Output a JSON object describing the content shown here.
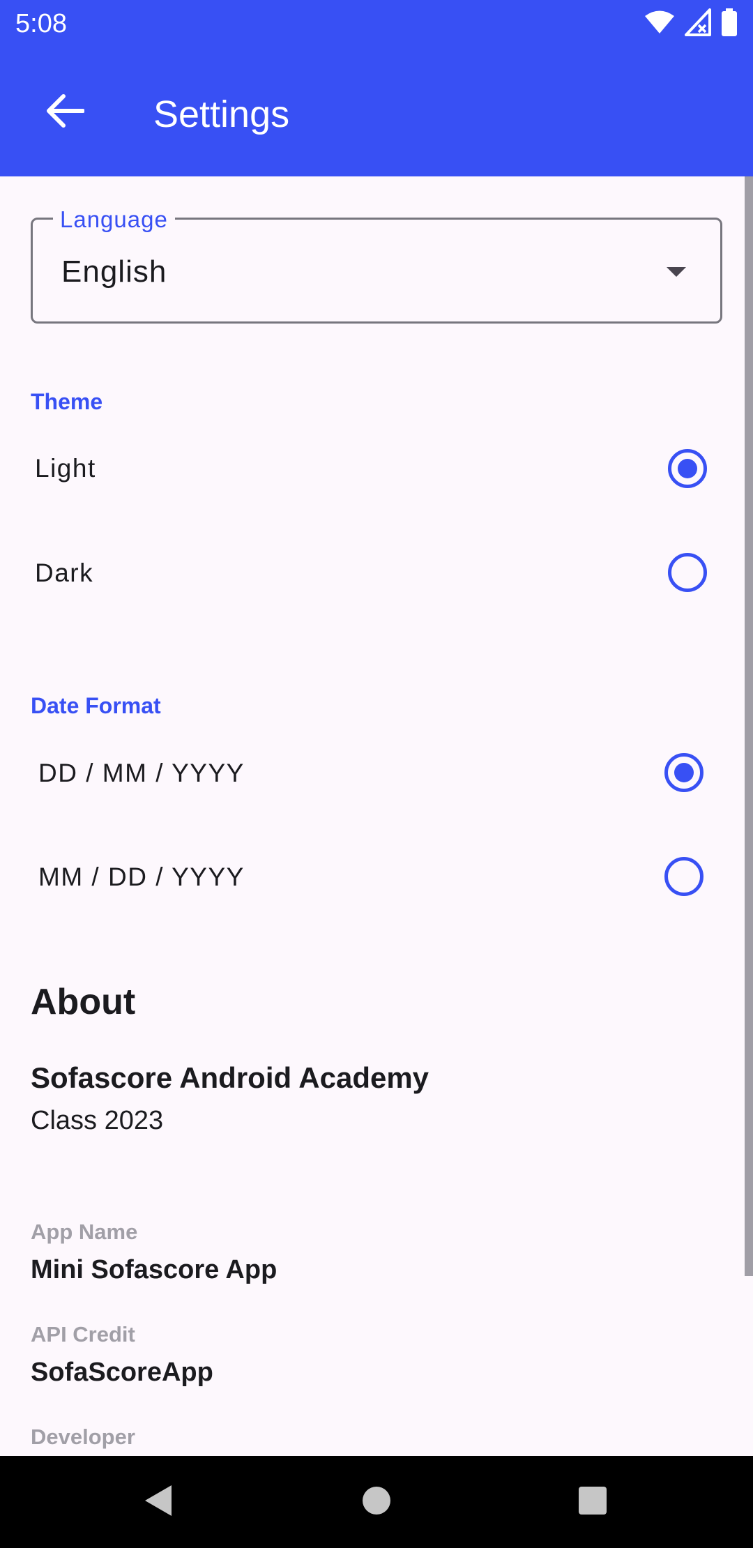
{
  "status_bar": {
    "time": "5:08",
    "icons": [
      "wifi-icon",
      "signal-off-icon",
      "battery-icon"
    ]
  },
  "app_bar": {
    "back_icon": "arrow-back-icon",
    "title": "Settings"
  },
  "language": {
    "label": "Language",
    "value": "English",
    "icon": "dropdown-arrow-icon"
  },
  "theme": {
    "title": "Theme",
    "options": [
      {
        "label": "Light",
        "selected": true
      },
      {
        "label": "Dark",
        "selected": false
      }
    ]
  },
  "date_format": {
    "title": "Date Format",
    "options": [
      {
        "label": "DD / MM / YYYY",
        "selected": true
      },
      {
        "label": "MM / DD / YYYY",
        "selected": false
      }
    ]
  },
  "about": {
    "title": "About",
    "org": "Sofascore Android Academy",
    "class": "Class 2023",
    "items": [
      {
        "label": "App Name",
        "value": "Mini Sofascore App"
      },
      {
        "label": "API Credit",
        "value": "SofaScoreApp"
      },
      {
        "label": "Developer",
        "value": ""
      }
    ]
  },
  "nav_bar": {
    "icons": [
      "nav-back-icon",
      "nav-home-icon",
      "nav-recents-icon"
    ]
  },
  "colors": {
    "primary": "#3850f4",
    "background": "#fdf8fd",
    "label_gray": "#a19fa7"
  }
}
